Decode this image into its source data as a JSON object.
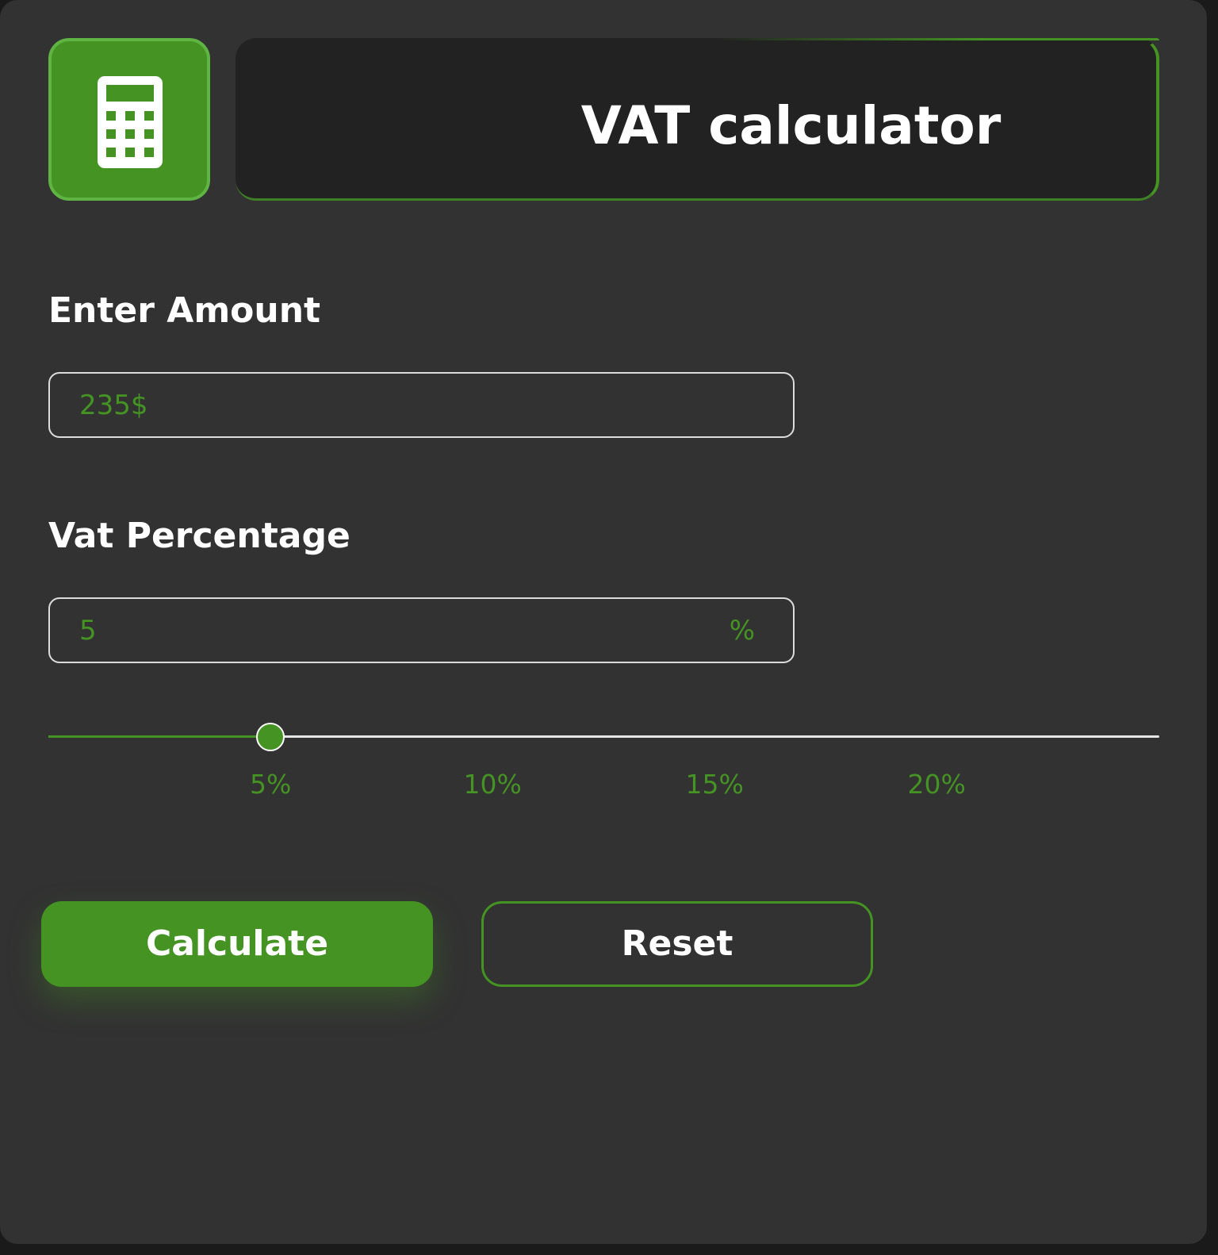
{
  "header": {
    "icon": "calculator-icon",
    "title": "VAT calculator"
  },
  "amount": {
    "label": "Enter Amount",
    "value": "235$"
  },
  "vat": {
    "label": "Vat Percentage",
    "value": "5",
    "suffix": "%"
  },
  "slider": {
    "min": 0,
    "max": 25,
    "value": 5,
    "ticks": [
      {
        "value": 5,
        "label": "5%"
      },
      {
        "value": 10,
        "label": "10%"
      },
      {
        "value": 15,
        "label": "15%"
      },
      {
        "value": 20,
        "label": "20%"
      }
    ]
  },
  "actions": {
    "calculate_label": "Calculate",
    "reset_label": "Reset"
  },
  "colors": {
    "accent": "#449323",
    "panel": "#323232",
    "title_box": "#222222",
    "text": "#ffffff"
  }
}
